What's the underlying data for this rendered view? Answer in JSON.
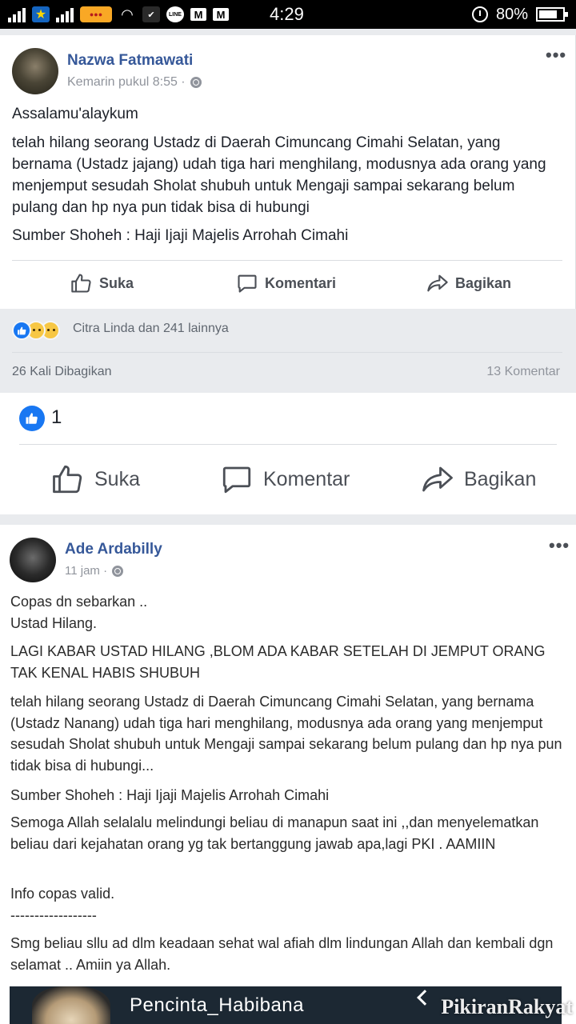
{
  "status_bar": {
    "time": "4:29",
    "battery": "80%",
    "battery_level": 0.8,
    "icons": [
      "signal-icon",
      "star-app-icon",
      "signal-icon",
      "promo-tag-icon",
      "wifi-icon",
      "checkmark-icon",
      "line-icon",
      "mail-icon",
      "mail-icon",
      "alarm-icon",
      "battery-icon"
    ]
  },
  "post1": {
    "author": "Nazwa Fatmawati",
    "time": "Kemarin pukul 8:55 ·",
    "greeting": "Assalamu'alaykum",
    "body": "telah hilang seorang Ustadz di Daerah Cimuncang Cimahi Selatan, yang bernama (Ustadz jajang) udah tiga hari menghilang, modusnya ada orang yang menjemput sesudah Sholat shubuh untuk Mengaji sampai sekarang belum pulang dan hp nya pun tidak bisa di hubungi",
    "source": "Sumber Shoheh : Haji Ijaji Majelis Arrohah Cimahi",
    "actions": {
      "like": "Suka",
      "comment": "Komentari",
      "share": "Bagikan"
    },
    "reactions_label": "Citra Linda dan 241 lainnya",
    "shares": "26 Kali Dibagikan",
    "comments": "13 Komentar"
  },
  "outer": {
    "like_count": "1",
    "actions": {
      "like": "Suka",
      "comment": "Komentar",
      "share": "Bagikan"
    }
  },
  "post2": {
    "author": "Ade Ardabilly",
    "time": "11 jam ·",
    "p1": "Copas dn sebarkan ..\nUstad Hilang.",
    "p2": "LAGI KABAR USTAD HILANG ,BLOM ADA KABAR SETELAH DI JEMPUT ORANG TAK KENAL HABIS SHUBUH",
    "p3": "telah hilang seorang Ustadz di Daerah Cimuncang Cimahi Selatan, yang bernama (Ustadz Nanang) udah tiga hari menghilang, modusnya ada orang yang menjemput sesudah Sholat shubuh untuk Mengaji sampai sekarang belum pulang dan hp nya pun tidak bisa di hubungi...",
    "p4": "Sumber Shoheh : Haji Ijaji Majelis Arrohah Cimahi",
    "p5": "Semoga Allah selalalu melindungi beliau di manapun saat ini ,,dan menyelematkan beliau dari kejahatan orang yg tak bertanggung jawab apa,lagi PKI . AAMIIN",
    "p6": "Info copas valid.\n------------------",
    "p7": "Smg beliau sllu ad dlm keadaan sehat wal afiah dlm lindungan Allah dan kembali dgn selamat .. Amiin ya Allah.",
    "banner": "Pencinta_Habibana"
  },
  "watermark": "PikiranRakyat"
}
